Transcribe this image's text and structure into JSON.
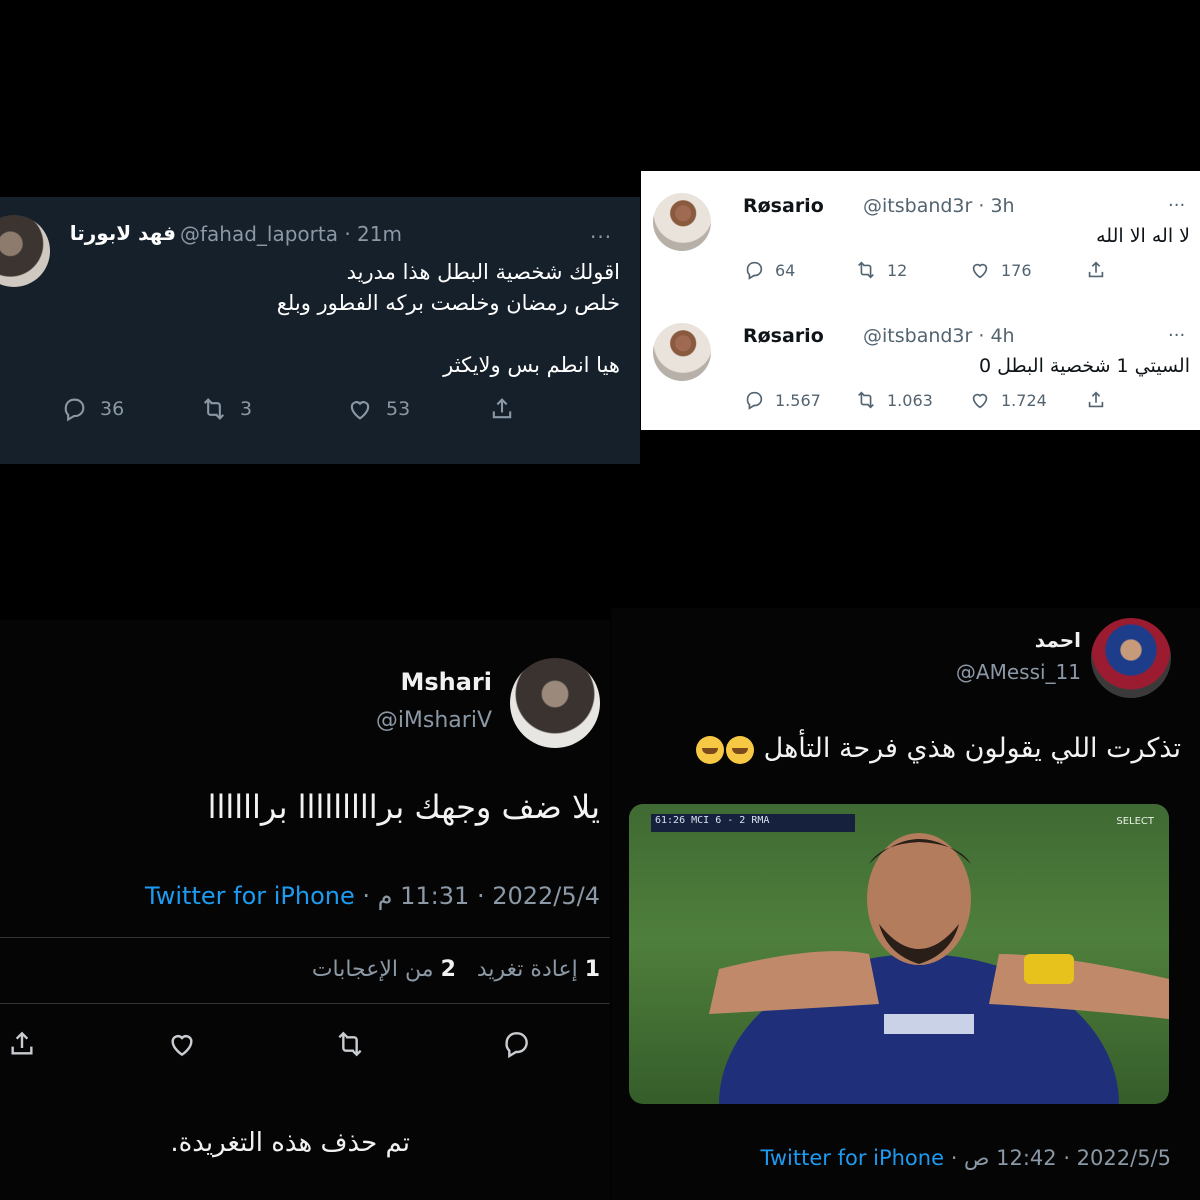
{
  "tweet_dark_top": {
    "name": "فهد لابورتا",
    "handle": "@fahad_laporta · 21m",
    "more": "···",
    "lines": [
      "اقولك شخصية البطل هذا مدريد",
      "خلص رمضان وخلصت بركه الفطور وبلع",
      "",
      "هيا انطم بس ولايكثر"
    ],
    "replies": "36",
    "retweets": "3",
    "likes": "53"
  },
  "tweet_light_1": {
    "name": "Røsario",
    "handle": "@itsband3r · 3h",
    "more": "···",
    "text": "لا اله الا الله",
    "replies": "64",
    "retweets": "12",
    "likes": "176"
  },
  "tweet_light_2": {
    "name": "Røsario",
    "handle": "@itsband3r · 4h",
    "more": "···",
    "text": "السيتي 1 شخصية البطل 0",
    "replies": "1.567",
    "retweets": "1.063",
    "likes": "1.724"
  },
  "tweet_mshari": {
    "name": "Mshari",
    "handle": "@iMshariV",
    "text": "يلا ضف وجهك برااااااااا براااااا",
    "meta_date": "2022/5/4 · 11:31 م · ",
    "meta_via": "Twitter for iPhone",
    "retweets_count": "1",
    "retweets_label": "إعادة تغريد",
    "likes_count": "2",
    "likes_label": "من الإعجابات",
    "deleted": "تم حذف هذه التغريدة."
  },
  "tweet_ahmed": {
    "name": "احمد",
    "handle": "@AMessi_11",
    "text": "تذكرت اللي يقولون هذي فرحة التأهل",
    "media_scorebug": "61:26  MCI 6 - 2 RMA",
    "media_broadcaster": "SELECT",
    "meta_date": "2022/5/5 · 12:42 ص · ",
    "meta_via": "Twitter for iPhone"
  },
  "icons": [
    "reply-icon",
    "retweet-icon",
    "like-icon",
    "share-icon",
    "crying-emoji"
  ]
}
